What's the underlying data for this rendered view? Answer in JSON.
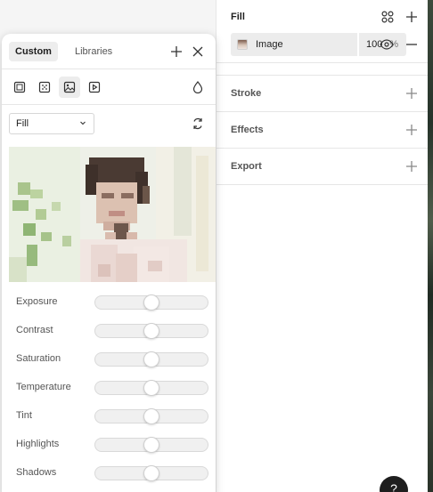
{
  "picker": {
    "tabs": [
      {
        "label": "Custom",
        "active": true
      },
      {
        "label": "Libraries",
        "active": false
      }
    ],
    "fill_types": [
      {
        "icon": "solid-fill-icon",
        "selected": false
      },
      {
        "icon": "gradient-fill-icon",
        "selected": false
      },
      {
        "icon": "image-fill-icon",
        "selected": true
      },
      {
        "icon": "video-fill-icon",
        "selected": false
      }
    ],
    "mode_select": {
      "value": "Fill"
    },
    "adjustments": [
      {
        "label": "Exposure",
        "value": 0
      },
      {
        "label": "Contrast",
        "value": 0
      },
      {
        "label": "Saturation",
        "value": 0
      },
      {
        "label": "Temperature",
        "value": 0
      },
      {
        "label": "Tint",
        "value": 0
      },
      {
        "label": "Highlights",
        "value": 0
      },
      {
        "label": "Shadows",
        "value": 0
      }
    ]
  },
  "properties": {
    "fill": {
      "title": "Fill",
      "layer": {
        "name": "Image",
        "opacity": "100",
        "unit": "%"
      }
    },
    "stroke": {
      "title": "Stroke"
    },
    "effects": {
      "title": "Effects"
    },
    "export": {
      "title": "Export"
    }
  },
  "help": {
    "label": "?"
  },
  "colors": {
    "accent_dark": "#1e1e1e",
    "panel_border": "#e6e6e6",
    "chip_bg": "#ececec"
  }
}
